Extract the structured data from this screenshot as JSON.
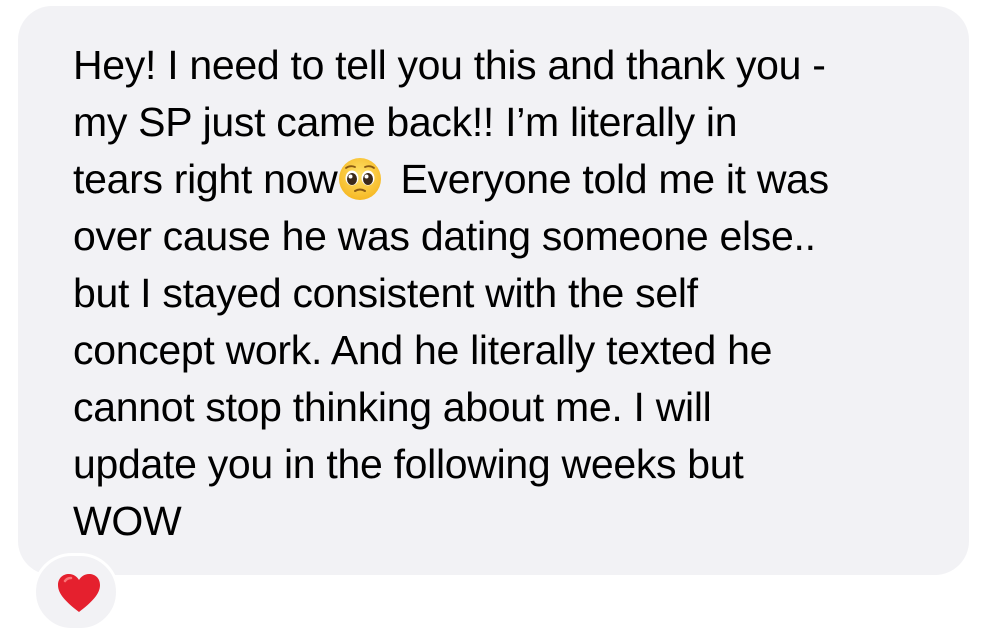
{
  "message": {
    "lines": [
      "Hey! I need to tell you this and thank you -",
      "my SP just came back!! I’m literally in",
      "tears right now",
      " Everyone told me it was",
      "over cause he was dating someone else..",
      "but I stayed consistent with the self",
      "concept work. And he literally texted he",
      "cannot stop thinking about me. I will",
      "update you in the following weeks but",
      "WOW"
    ],
    "emoji": "pleading-face-emoji"
  },
  "reaction": {
    "icon": "red-heart-icon",
    "color": "#e5202e"
  },
  "colors": {
    "bubble": "#f2f2f5",
    "text": "#000000",
    "background": "#ffffff"
  }
}
